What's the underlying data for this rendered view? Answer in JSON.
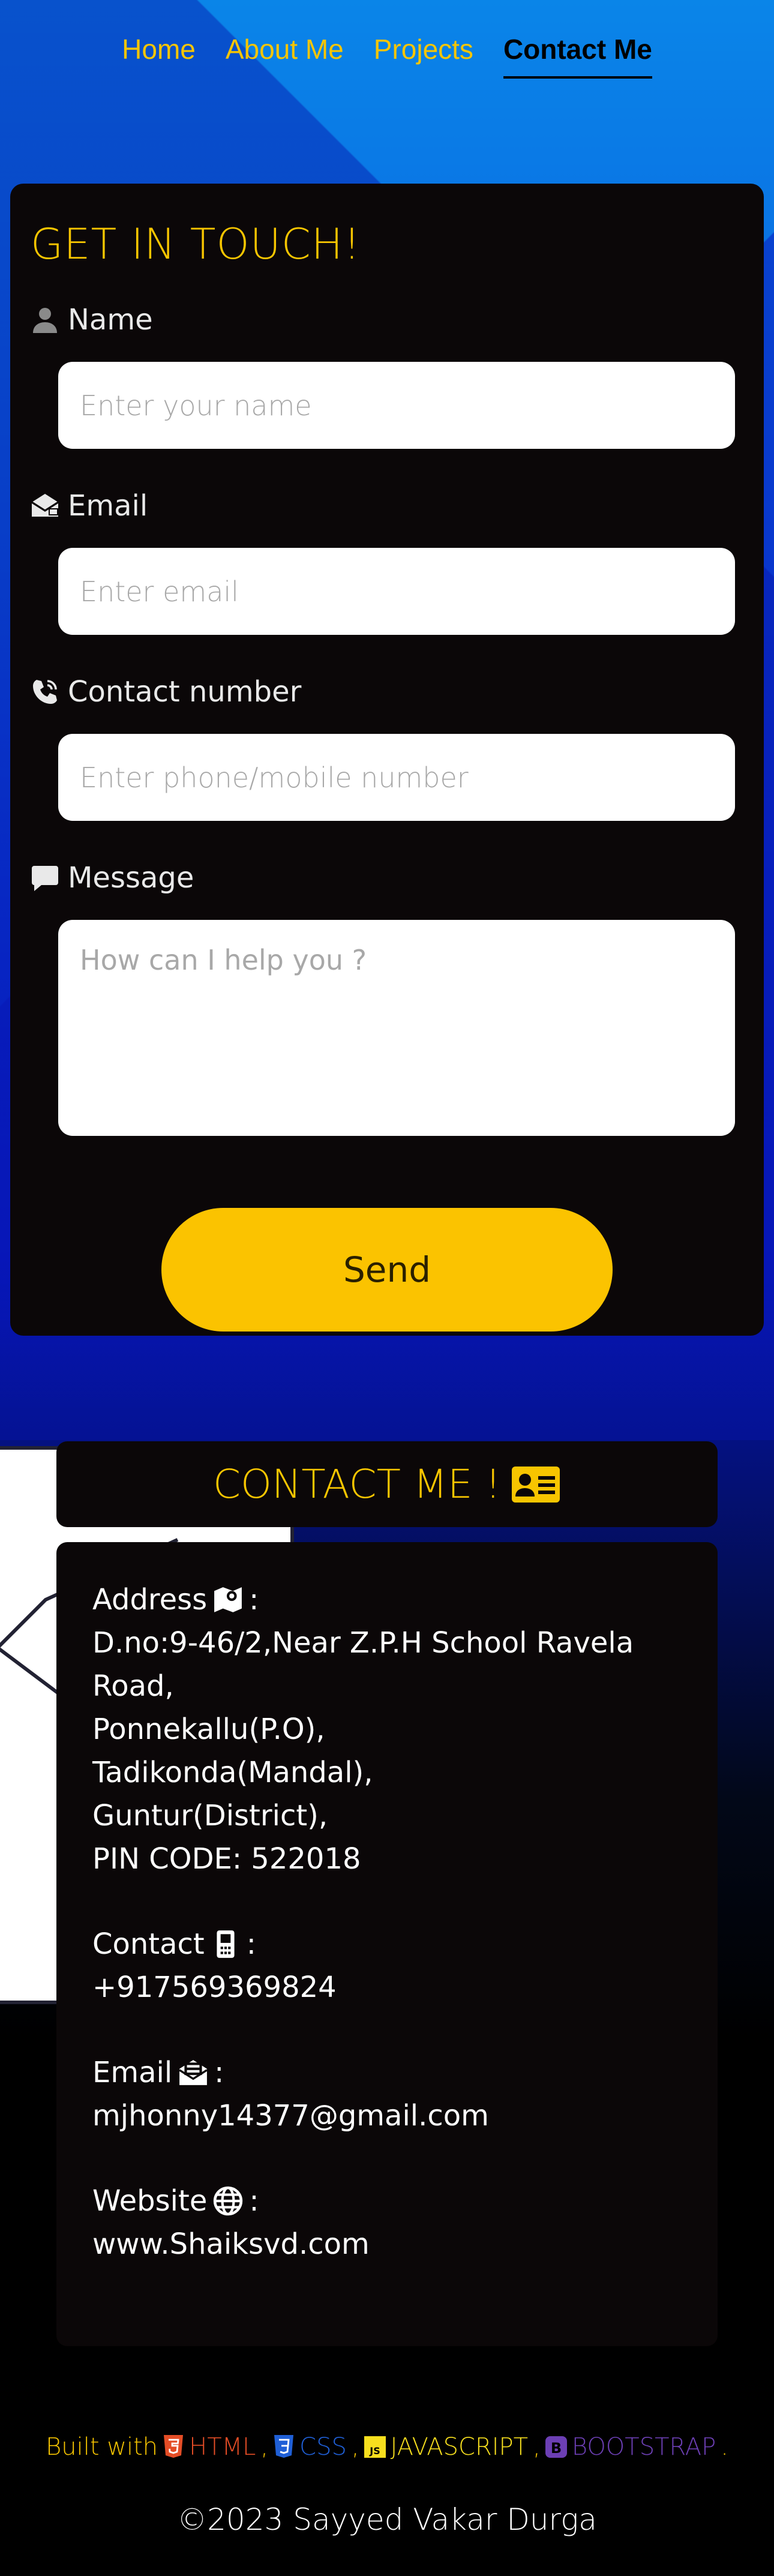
{
  "nav": {
    "items": [
      {
        "label": "Home"
      },
      {
        "label": "About Me"
      },
      {
        "label": "Projects"
      },
      {
        "label": "Contact Me"
      }
    ]
  },
  "form": {
    "title": "GET IN TOUCH!",
    "name_label": "Name",
    "name_placeholder": "Enter your name",
    "email_label": "Email",
    "email_placeholder": "Enter email",
    "phone_label": "Contact number",
    "phone_placeholder": "Enter phone/mobile number",
    "message_label": "Message",
    "message_placeholder": "How can I help you ?",
    "send_label": "Send"
  },
  "contact": {
    "header": "CONTACT ME !",
    "address_title": "Address",
    "address_value": "D.no:9-46/2,Near Z.P.H School Ravela Road,\nPonnekallu(P.O),\nTadikonda(Mandal),\nGuntur(District),\nPIN CODE: 522018",
    "contact_title": "Contact",
    "contact_value": "+917569369824",
    "email_title": "Email",
    "email_value": "mjhonny14377@gmail.com",
    "website_title": "Website",
    "website_value": "www.Shaiksvd.com"
  },
  "footer": {
    "built_with": "Built with",
    "html": "HTML",
    "css": "CSS",
    "js": "JAVASCRIPT",
    "bootstrap": "BOOTSTRAP",
    "copyright_symbol": "©",
    "copyright": "2023 Sayyed Vakar Durga"
  },
  "colors": {
    "accent": "#f7c500",
    "card": "#0b0708",
    "send_button": "#fbc300"
  }
}
